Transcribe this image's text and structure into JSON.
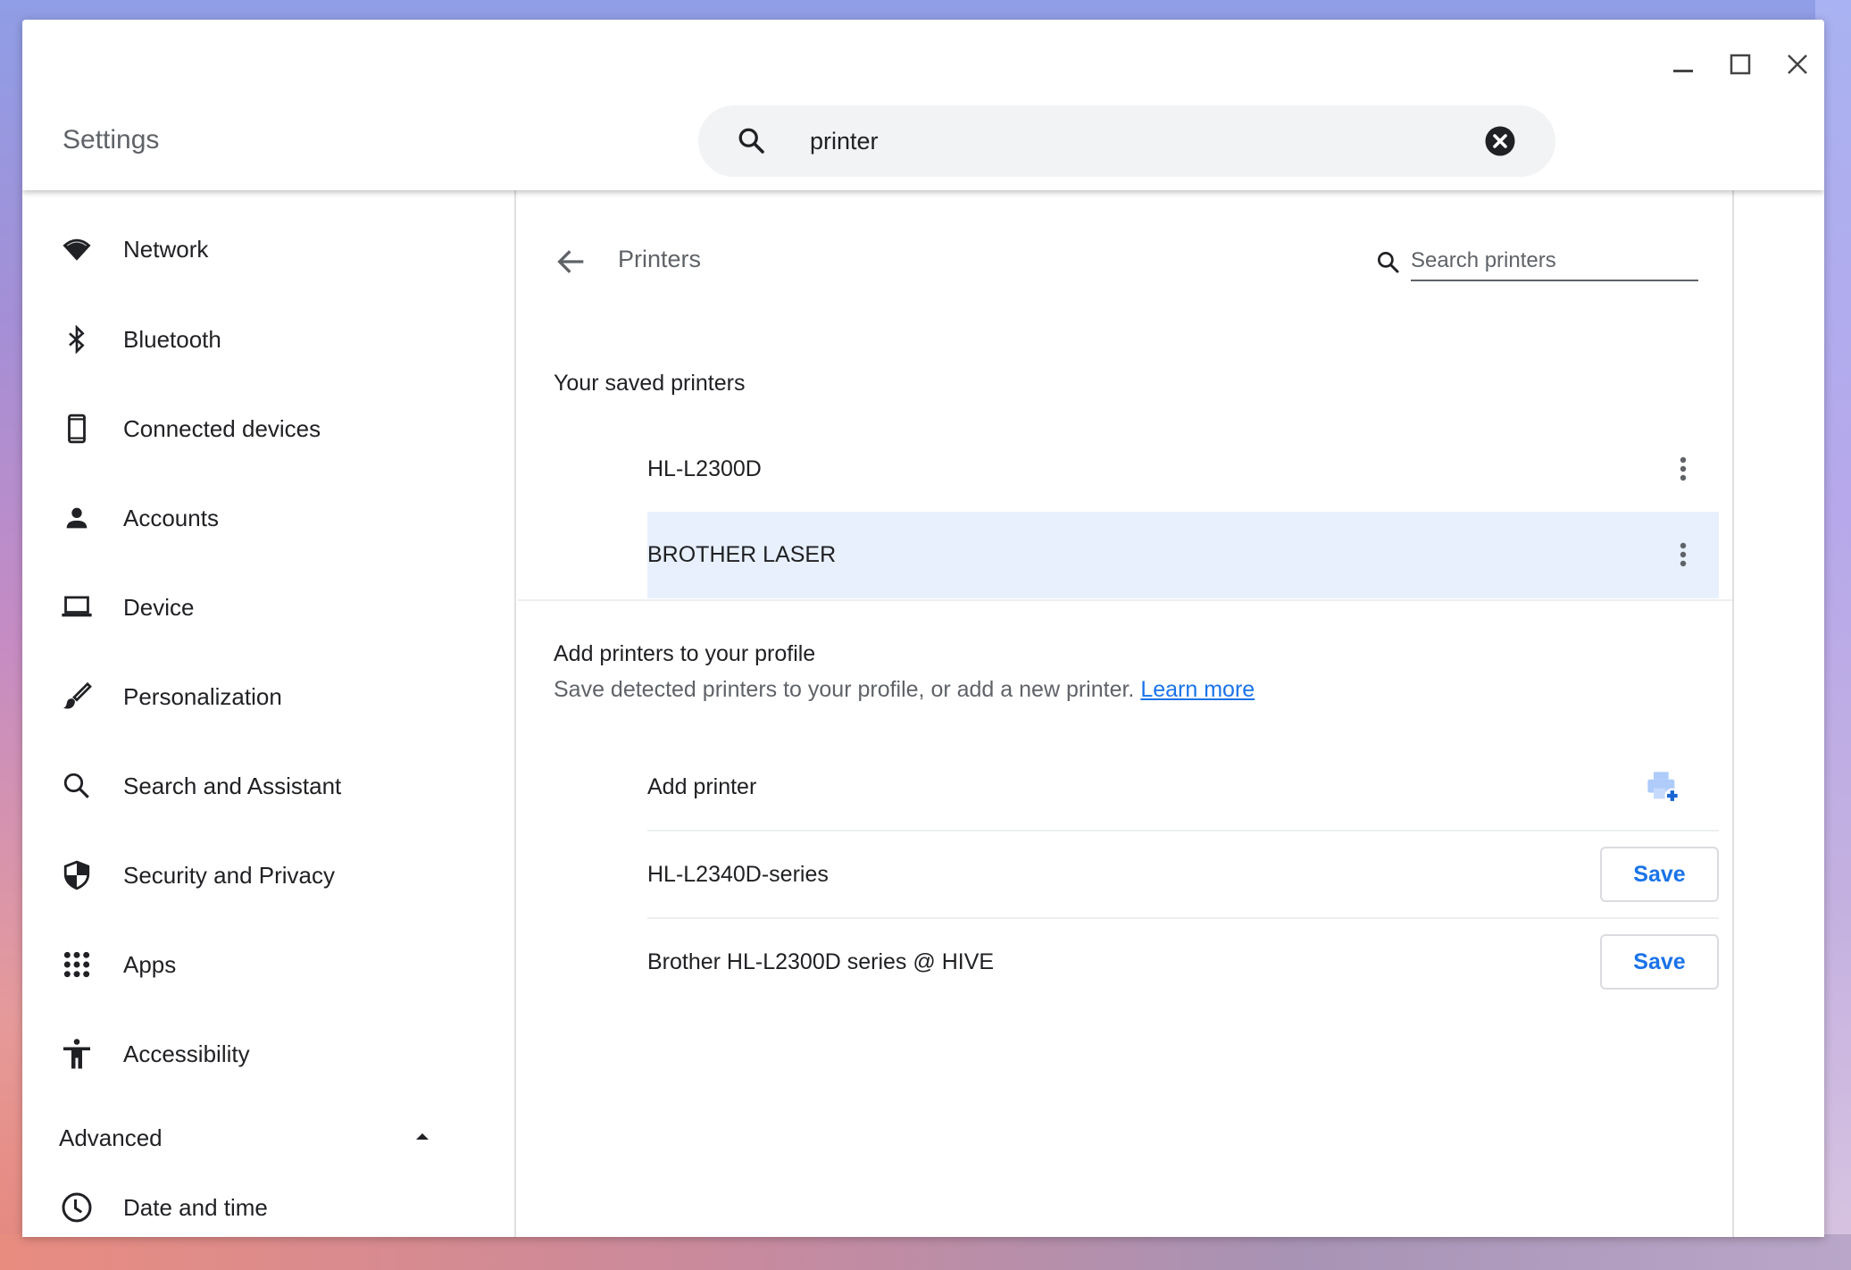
{
  "window": {
    "title": "Settings",
    "controls": {
      "minimize": "minimize-icon",
      "maximize": "maximize-icon",
      "close": "close-icon"
    }
  },
  "search": {
    "value": "printer",
    "icon": "search-icon",
    "clear_icon": "clear-icon"
  },
  "sidebar": {
    "items": [
      {
        "label": "Network",
        "icon": "wifi-icon"
      },
      {
        "label": "Bluetooth",
        "icon": "bluetooth-icon"
      },
      {
        "label": "Connected devices",
        "icon": "phone-icon"
      },
      {
        "label": "Accounts",
        "icon": "person-icon"
      },
      {
        "label": "Device",
        "icon": "laptop-icon"
      },
      {
        "label": "Personalization",
        "icon": "brush-icon"
      },
      {
        "label": "Search and Assistant",
        "icon": "search-icon"
      },
      {
        "label": "Security and Privacy",
        "icon": "shield-icon"
      },
      {
        "label": "Apps",
        "icon": "apps-grid-icon"
      },
      {
        "label": "Accessibility",
        "icon": "accessibility-icon"
      }
    ],
    "advanced": {
      "label": "Advanced",
      "expanded": true
    },
    "advanced_items": [
      {
        "label": "Date and time",
        "icon": "clock-icon"
      }
    ]
  },
  "page": {
    "title": "Printers",
    "back_icon": "back-arrow-icon",
    "search_placeholder": "Search printers",
    "saved_section": {
      "title": "Your saved printers",
      "printers": [
        {
          "name": "HL-L2300D",
          "selected": false
        },
        {
          "name": "BROTHER LASER",
          "selected": true
        }
      ]
    },
    "add_section": {
      "title": "Add printers to your profile",
      "description": "Save detected printers to your profile, or add a new printer.",
      "link": "Learn more",
      "add_printer_label": "Add printer",
      "detected_printers": [
        {
          "name": "HL-L2340D-series",
          "action": "Save"
        },
        {
          "name": "Brother HL-L2300D series @ HIVE",
          "action": "Save"
        }
      ]
    }
  },
  "colors": {
    "accent": "#1a73e8",
    "selected_row": "#e8f0fe",
    "text_primary": "#202124",
    "text_secondary": "#5f6368"
  }
}
